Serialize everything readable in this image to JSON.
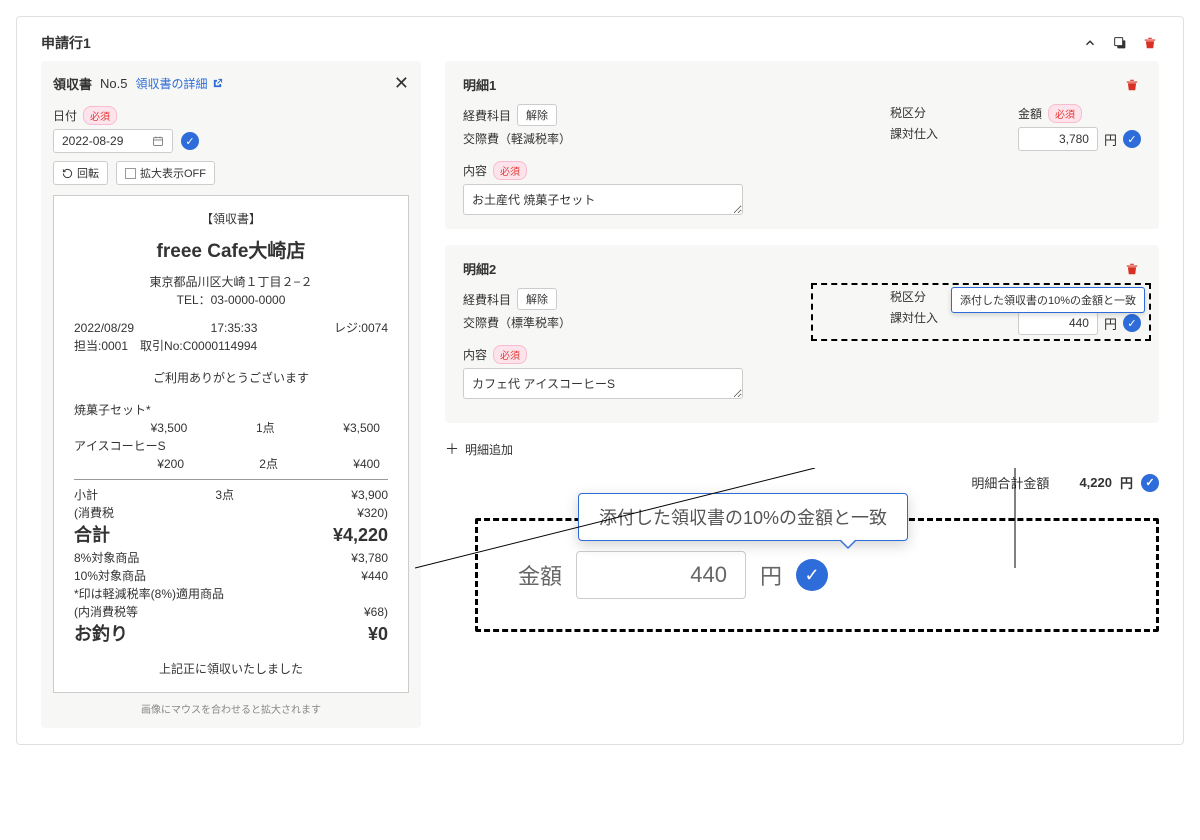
{
  "header": {
    "title": "申請行1"
  },
  "receipt_panel": {
    "title": "領収書",
    "number": "No.5",
    "detail_link": "領収書の詳細",
    "date_label": "日付",
    "required": "必須",
    "date_value": "2022-08-29",
    "rotate": "回転",
    "zoom_off": "拡大表示OFF",
    "caption": "画像にマウスを合わせると拡大されます"
  },
  "receipt_image": {
    "header": "【領収書】",
    "store": "freee Cafe大崎店",
    "address": "東京都品川区大崎１丁目２−２",
    "tel": "TEL：03-0000-0000",
    "meta1_left": "2022/08/29",
    "meta1_mid": "17:35:33",
    "meta1_right": "レジ:0074",
    "meta2": "担当:0001　取引No:C0000114994",
    "thanks": "ご利用ありがとうございます",
    "item1_name": "焼菓子セット*",
    "item1_unit": "¥3,500",
    "item1_qty": "1点",
    "item1_total": "¥3,500",
    "item2_name": "アイスコーヒーS",
    "item2_unit": "¥200",
    "item2_qty": "2点",
    "item2_total": "¥400",
    "subtotal_label": "小計",
    "subtotal_qty": "3点",
    "subtotal_val": "¥3,900",
    "tax_label": "(消費税",
    "tax_val": "¥320)",
    "total_label": "合計",
    "total_val": "¥4,220",
    "group8_label": "8%対象商品",
    "group8_val": "¥3,780",
    "group10_label": "10%対象商品",
    "group10_val": "¥440",
    "note": "*印は軽減税率(8%)適用商品",
    "innertax_label": "(内消費税等",
    "innertax_val": "¥68)",
    "change_label": "お釣り",
    "change_val": "¥0",
    "footer": "上記正に領収いたしました"
  },
  "detail1": {
    "title": "明細1",
    "account_label": "経費科目",
    "unlink": "解除",
    "account_val": "交際費（軽減税率）",
    "tax_label": "税区分",
    "tax_val": "課対仕入",
    "amount_label": "金額",
    "amount_val": "3,780",
    "currency": "円",
    "content_label": "内容",
    "content_val": "お土産代 焼菓子セット"
  },
  "detail2": {
    "title": "明細2",
    "account_label": "経費科目",
    "unlink": "解除",
    "account_val": "交際費（標準税率）",
    "tax_label": "税区分",
    "tax_val": "課対仕入",
    "amount_label": "金額",
    "amount_val": "440",
    "currency": "円",
    "content_label": "内容",
    "content_val": "カフェ代 アイスコーヒーS",
    "tooltip": "添付した領収書の10%の金額と一致"
  },
  "add_row": "明細追加",
  "totals": {
    "label": "明細合計金額",
    "value": "4,220",
    "currency": "円"
  },
  "zoom": {
    "label": "金額",
    "value": "440",
    "currency": "円",
    "tooltip": "添付した領収書の10%の金額と一致"
  }
}
